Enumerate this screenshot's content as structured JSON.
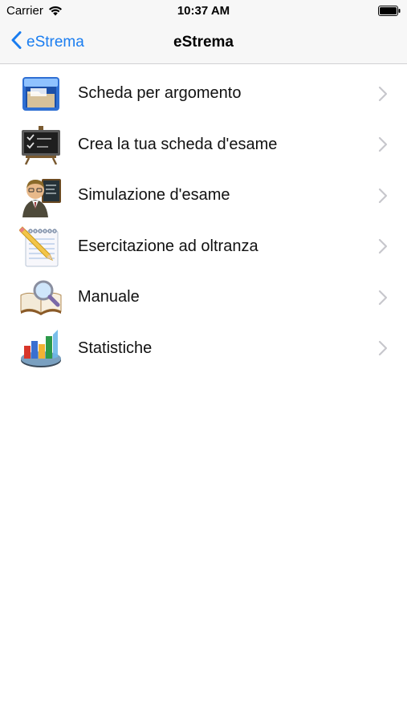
{
  "status_bar": {
    "carrier": "Carrier",
    "time": "10:37 AM"
  },
  "nav_bar": {
    "back_label": "eStrema",
    "title": "eStrema"
  },
  "menu": {
    "items": [
      {
        "label": "Scheda per argomento",
        "icon": "folder-icon"
      },
      {
        "label": "Crea la tua scheda d'esame",
        "icon": "blackboard-icon"
      },
      {
        "label": "Simulazione d'esame",
        "icon": "teacher-icon"
      },
      {
        "label": "Esercitazione ad oltranza",
        "icon": "notepad-pencil-icon"
      },
      {
        "label": "Manuale",
        "icon": "book-magnifier-icon"
      },
      {
        "label": "Statistiche",
        "icon": "bar-chart-icon"
      }
    ]
  },
  "colors": {
    "accent": "#1a7df0",
    "chevron": "#c7c7cc",
    "bar_background": "#f7f7f7"
  }
}
